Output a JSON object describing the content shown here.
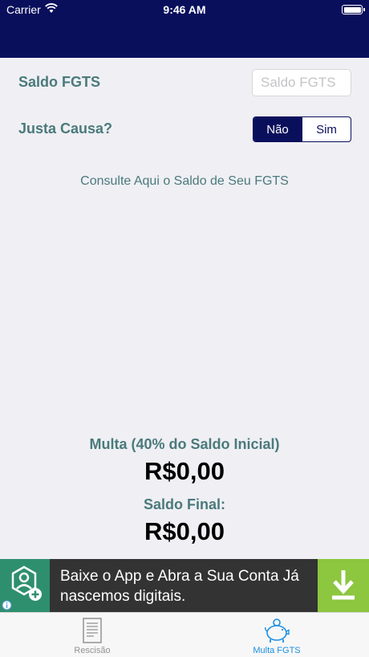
{
  "status_bar": {
    "carrier": "Carrier",
    "time": "9:46 AM"
  },
  "form": {
    "saldo_label": "Saldo FGTS",
    "saldo_placeholder": "Saldo FGTS",
    "saldo_value": "",
    "justa_causa_label": "Justa Causa?",
    "segment_options": [
      "Não",
      "Sim"
    ],
    "segment_selected": "Não"
  },
  "consult_link": "Consulte Aqui o Saldo de Seu FGTS",
  "results": {
    "multa_label": "Multa (40% do Saldo Inicial)",
    "multa_value": "R$0,00",
    "saldo_final_label": "Saldo Final:",
    "saldo_final_value": "R$0,00"
  },
  "ad_banner": {
    "line1": "Baixe o App e Abra a Sua Conta Já",
    "line2": "nascemos digitais.",
    "logo_icon": "bank-app-logo-icon",
    "action_icon": "download-icon",
    "info_icon": "info-icon"
  },
  "tab_bar": {
    "tabs": [
      {
        "label": "Rescisão",
        "icon": "document-icon",
        "selected": false
      },
      {
        "label": "Multa FGTS",
        "icon": "piggy-bank-icon",
        "selected": true
      }
    ]
  },
  "colors": {
    "nav_background": "#0a0f5c",
    "label_text": "#4a7a7b",
    "tab_active": "#1d8fe0",
    "tab_inactive": "#929292",
    "ad_background": "#333333",
    "ad_logo_background": "#2e8f6e",
    "ad_download_background": "#8dc63f"
  }
}
